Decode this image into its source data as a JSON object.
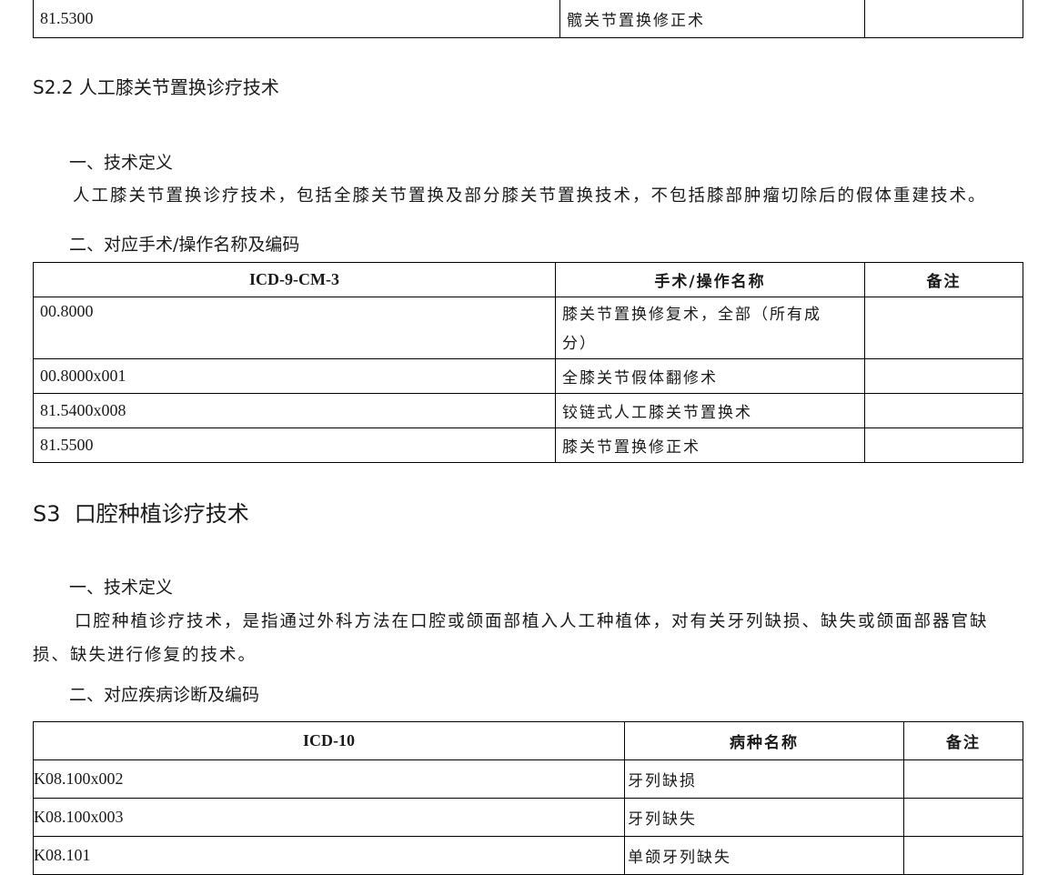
{
  "top_table": {
    "row": {
      "code": "81.5300",
      "name": "髋关节置换修正术",
      "note": ""
    }
  },
  "section_s22": {
    "heading": "S2.2 人工膝关节置换诊疗技术",
    "def_title": "一、技术定义",
    "def_text": "人工膝关节置换诊疗技术，包括全膝关节置换及部分膝关节置换技术，不包括膝部肿瘤切除后的假体重建技术。",
    "ops_title": "二、对应手术/操作名称及编码",
    "table": {
      "headers": [
        "ICD-9-CM-3",
        "手术/操作名称",
        "备注"
      ],
      "rows": [
        {
          "code": "00.8000",
          "name_line1": "膝关节置换修复术，全部（所有成",
          "name_line2": "分）",
          "note": ""
        },
        {
          "code": "00.8000x001",
          "name": "全膝关节假体翻修术",
          "note": ""
        },
        {
          "code": "81.5400x008",
          "name": "铰链式人工膝关节置换术",
          "note": ""
        },
        {
          "code": "81.5500",
          "name": "膝关节置换修正术",
          "note": ""
        }
      ]
    }
  },
  "section_s3": {
    "heading": "S3  口腔种植诊疗技术",
    "def_title": "一、技术定义",
    "def_line1": "口腔种植诊疗技术，是指通过外科方法在口腔或颌面部植入人工种植体，对有关牙列缺损、缺失或颌面部器官缺",
    "def_line2": "损、缺失进行修复的技术。",
    "diag_title": "二、对应疾病诊断及编码",
    "table": {
      "headers": [
        "ICD-10",
        "病种名称",
        "备注"
      ],
      "rows": [
        {
          "code": "K08.100x002",
          "name": "牙列缺损",
          "note": ""
        },
        {
          "code": "K08.100x003",
          "name": "牙列缺失",
          "note": ""
        },
        {
          "code": "K08.101",
          "name": "单颌牙列缺失",
          "note": ""
        }
      ]
    }
  }
}
